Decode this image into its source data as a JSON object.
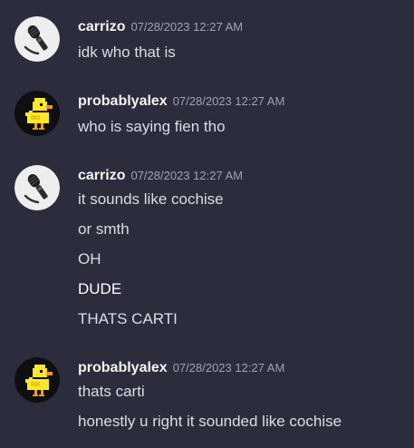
{
  "groups": [
    {
      "username": "carrizo",
      "timestamp": "07/28/2023 12:27 AM",
      "avatar_icon": "microphone-icon",
      "messages": [
        "idk who that is"
      ]
    },
    {
      "username": "probablyalex",
      "timestamp": "07/28/2023 12:27 AM",
      "avatar_icon": "pixel-duck-icon",
      "messages": [
        "who is saying fien tho"
      ]
    },
    {
      "username": "carrizo",
      "timestamp": "07/28/2023 12:27 AM",
      "avatar_icon": "microphone-icon",
      "messages": [
        "it sounds like cochise",
        "or smth",
        "OH",
        "DUDE",
        "THATS CARTI"
      ]
    },
    {
      "username": "probablyalex",
      "timestamp": "07/28/2023 12:27 AM",
      "avatar_icon": "pixel-duck-icon",
      "messages": [
        "thats carti",
        "honestly u right it sounded like cochise"
      ]
    }
  ],
  "colors": {
    "background": "#2b2d3c",
    "username": "#f2f3f5",
    "timestamp": "#a0a3ad",
    "message_text": "#dbdee1"
  }
}
